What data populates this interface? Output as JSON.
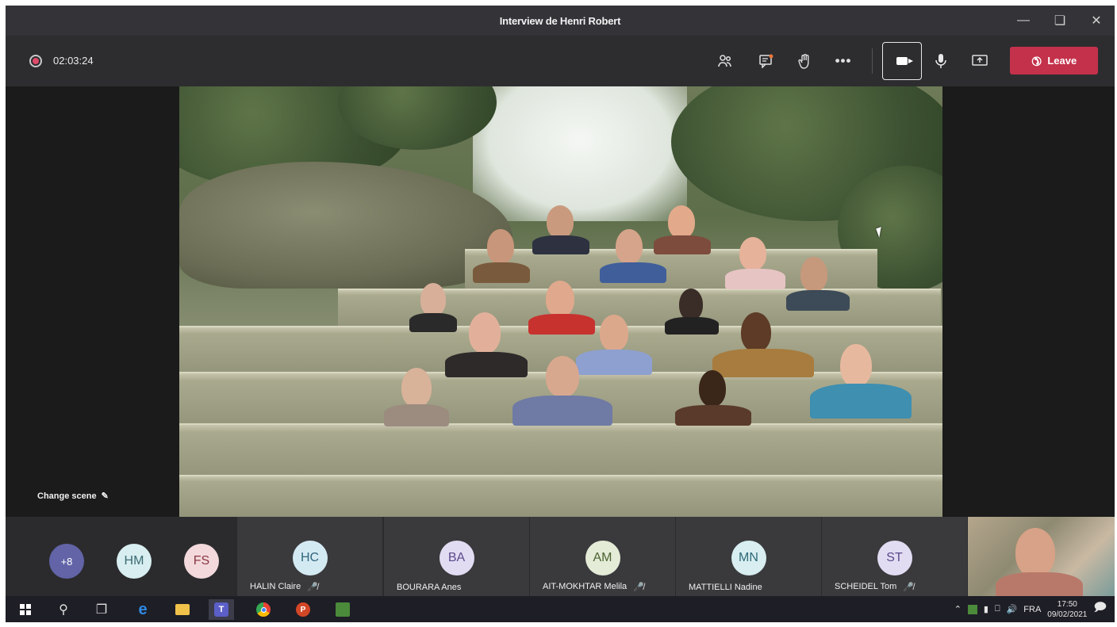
{
  "window": {
    "title": "Interview de Henri Robert"
  },
  "toolbar": {
    "timer": "02:03:24",
    "leave_label": "Leave"
  },
  "stage": {
    "change_scene_label": "Change scene"
  },
  "strip": {
    "overflow_count": "+8",
    "small_avatars": [
      {
        "initials": "HM"
      },
      {
        "initials": "FS"
      }
    ],
    "tiles": [
      {
        "initials": "HC",
        "name": "HALIN Claire",
        "muted": true
      },
      {
        "initials": "BA",
        "name": "BOURARA Anes",
        "muted": false
      },
      {
        "initials": "AM",
        "name": "AIT-MOKHTAR Melila",
        "muted": true
      },
      {
        "initials": "MN",
        "name": "MATTIELLI Nadine",
        "muted": false
      },
      {
        "initials": "ST",
        "name": "SCHEIDEL Tom",
        "muted": true
      }
    ]
  },
  "taskbar": {
    "language": "FRA",
    "time": "17:50",
    "date": "09/02/2021"
  },
  "colors": {
    "leave": "#c4314b",
    "accent_purple": "#6264a7",
    "record": "#e04b6a"
  }
}
